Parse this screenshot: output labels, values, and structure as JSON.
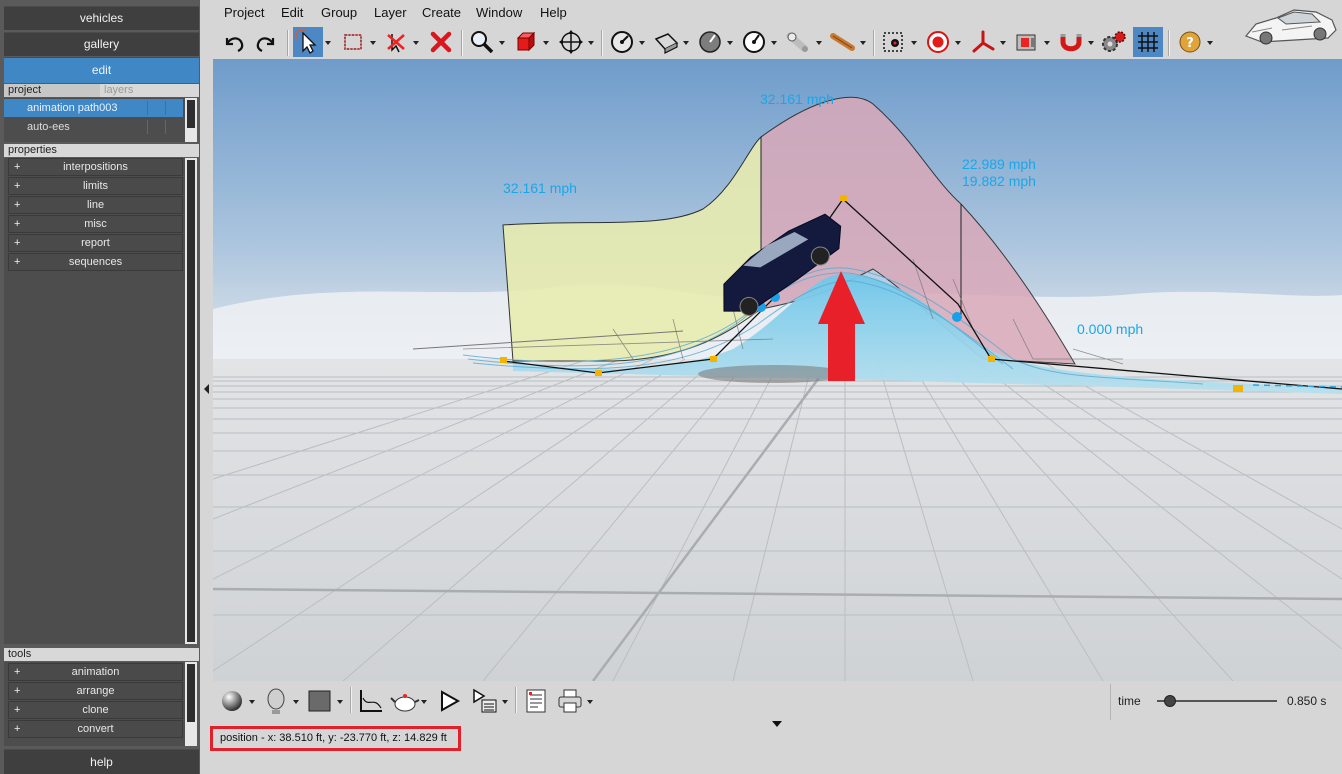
{
  "nav": {
    "vehicles": "vehicles",
    "gallery": "gallery",
    "edit": "edit",
    "help": "help"
  },
  "project_panel": {
    "tab_project": "project",
    "tab_layers": "layers",
    "items": [
      {
        "label": "animation path003",
        "selected": true
      },
      {
        "label": "auto-ees",
        "selected": false
      }
    ]
  },
  "properties": {
    "header": "properties",
    "items": [
      "interpositions",
      "limits",
      "line",
      "misc",
      "report",
      "sequences"
    ]
  },
  "tools": {
    "header": "tools",
    "items": [
      "animation",
      "arrange",
      "clone",
      "convert"
    ]
  },
  "menu": [
    "Project",
    "Edit",
    "Group",
    "Layer",
    "Create",
    "Window",
    "Help"
  ],
  "toolbar_icons": [
    "undo-icon",
    "redo-icon",
    "select-arrow-icon",
    "marquee-select-icon",
    "no-select-icon",
    "delete-icon",
    "zoom-icon",
    "cube-icon",
    "move-icon",
    "gauge-icon",
    "plane-icon",
    "dial-icon",
    "speed-icon",
    "cylinder-icon",
    "bat-icon",
    "record-icon",
    "target-icon",
    "axis-icon",
    "camera-icon",
    "magnet-icon",
    "gears-icon",
    "grid-icon",
    "help-icon"
  ],
  "viewport": {
    "speed_labels": [
      "32.161 mph",
      "32.161 mph",
      "22.989 mph",
      "19.882 mph",
      "0.000 mph"
    ],
    "colors": {
      "sky_top": "#6f9ccb",
      "sky_bottom": "#e4e8ec",
      "ground": "#d4d7da",
      "label": "#1aa7e8",
      "arrow": "#e0202a"
    }
  },
  "timeline": {
    "label": "time",
    "value": "0.850 s",
    "fraction": 0.1
  },
  "status": {
    "position_text": "position - x: 38.510 ft, y: -23.770 ft, z: 14.829 ft"
  }
}
